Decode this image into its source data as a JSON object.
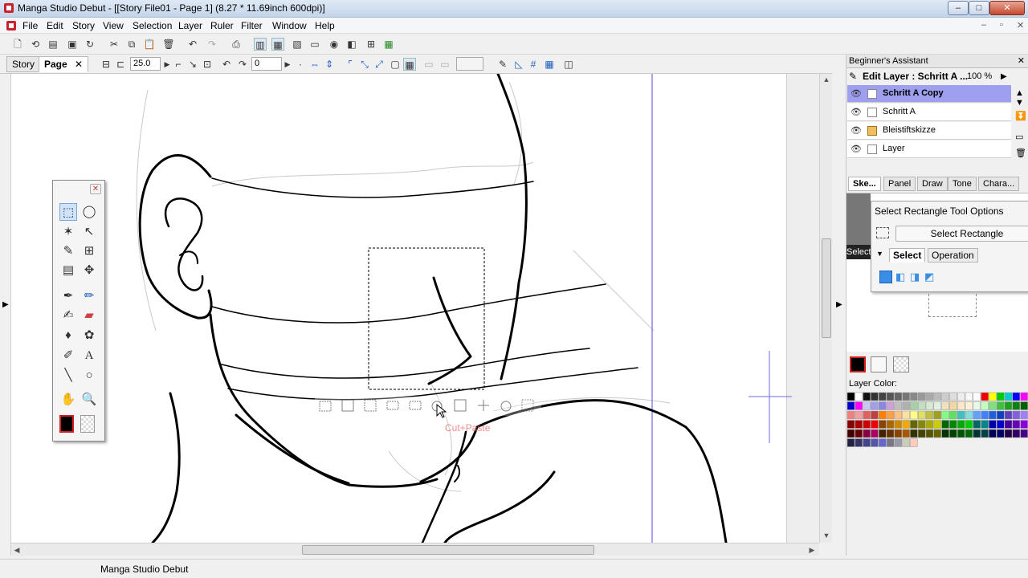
{
  "window": {
    "title": "Manga Studio Debut - [[Story File01 - Page 1] (8.27 * 11.69inch 600dpi)]",
    "controls": {
      "minimize": "–",
      "maximize": "□",
      "close": "✕"
    }
  },
  "menu": {
    "items": [
      "File",
      "Edit",
      "Story",
      "View",
      "Selection",
      "Layer",
      "Ruler",
      "Filter",
      "Window",
      "Help"
    ],
    "mdi_controls": [
      "–",
      "▫",
      "✕"
    ]
  },
  "toolbar": {
    "tabs": {
      "story": "Story",
      "page": "Page",
      "page_close": "✕"
    },
    "zoom_value": "25.0",
    "rotate_value": "0"
  },
  "canvas": {
    "hint_label": "Cut+Paste"
  },
  "tools_palette": {
    "close": "✕"
  },
  "right_panel": {
    "assistant_title": "Beginner's Assistant",
    "close": "✕",
    "edit_layer_label": "Edit Layer : Schritt A ...",
    "opacity": "100 %",
    "layers": [
      {
        "name": "Schritt A Copy",
        "selected": true
      },
      {
        "name": "Schritt A",
        "selected": false
      },
      {
        "name": "Bleistiftskizze",
        "selected": false
      },
      {
        "name": "Layer",
        "selected": false
      }
    ],
    "tabs": [
      "Ske...",
      "Panel",
      "Draw",
      "Tone",
      "Chara..."
    ],
    "partial_label": "Select",
    "options": {
      "title": "Select Rectangle Tool Options",
      "button": "Select Rectangle",
      "tabs": [
        "Select",
        "Operation"
      ]
    },
    "layer_color_label": "Layer Color:",
    "colors": {
      "main": "#000000",
      "sub": "#ffffff",
      "accent_selected": "#9f9ff0"
    }
  },
  "status": {
    "text": "Manga Studio Debut"
  }
}
